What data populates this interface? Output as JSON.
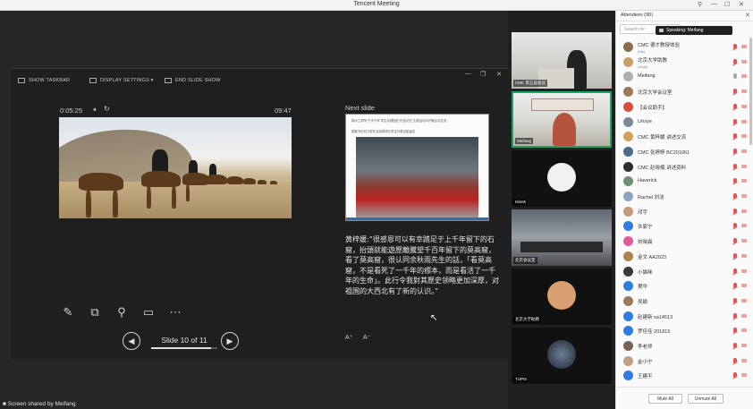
{
  "window": {
    "title": "Tencent Meeting",
    "controls": [
      "⚲",
      "—",
      "☐",
      "✕"
    ]
  },
  "presenter": {
    "toolbar": {
      "show_taskbar": "SHOW TASKBAR",
      "display_settings": "DISPLAY SETTINGS ▾",
      "end_slide_show": "END SLIDE SHOW"
    },
    "window_controls": [
      "—",
      "❐",
      "✕"
    ],
    "timer": "0:05:25",
    "pause_glyph": "⏸",
    "reset_glyph": "↻",
    "clock": "09:47",
    "tool_glyphs": [
      "✎",
      "⧉",
      "⚲",
      "▭",
      "⋯"
    ],
    "slide_counter": "Slide 10 of 11",
    "slide_progress": 0.909,
    "prev_glyph": "◀",
    "next_glyph": "▶",
    "next_slide_label": "Next slide",
    "next_slide_text1": "锦州工学院“千手千年”学生实践团在“红色记忆”主题活动中开展互动交流",
    "next_slide_text2": "团委书记刘力宏在活动现场与学生代表合影留念",
    "notes": "黄梓媛:“很感恩可以有幸踏足于上千年留下的石窟，抬頭就能遊歷離騰望千百年留下的莫高窟，看了莫高窟，很认同余秋雨先生的話，「看莫高窟，不是看死了一千年的標本，而是看活了一千年的生命」。此行令我對其歷史领略更加深厚，对祖国的大西北有了新的认识。”",
    "font_up": "A⁺",
    "font_down": "A⁻",
    "cursor_glyph": "↖"
  },
  "status_bar": {
    "text": "Screen shared by Meifang",
    "glyph": "■"
  },
  "video_tiles": [
    {
      "label": "CMC 第五届会议"
    },
    {
      "label": "Meifang"
    },
    {
      "label": "MinMi"
    },
    {
      "label": "北京会议室"
    },
    {
      "label": "北京大学助教"
    },
    {
      "label": "TUPM"
    }
  ],
  "attendees": {
    "title": "Attendees (90)",
    "close_glyph": "✕",
    "search_placeholder": "Search for",
    "speaking": "Speaking: Meifang",
    "list": [
      {
        "name": "CMC 德才教授体验",
        "sub": "(Me)",
        "color": "#8a6d4f",
        "mic": "muted"
      },
      {
        "name": "北京大学助教",
        "sub": "(Host)",
        "color": "#c9a06a",
        "mic": "muted"
      },
      {
        "name": "Meifang",
        "sub": "",
        "color": "#b0b0b0",
        "mic": "grey"
      },
      {
        "name": "北京大学会议室",
        "sub": "",
        "color": "#9c7c56",
        "mic": "muted"
      },
      {
        "name": "【会议助手】",
        "sub": "",
        "color": "#d94f3d",
        "mic": "muted"
      },
      {
        "name": "Lihsye",
        "sub": "",
        "color": "#7a8a9a",
        "mic": "muted"
      },
      {
        "name": "CMC 黄梓媛 讲述交流",
        "sub": "",
        "color": "#d4a05a",
        "mic": "muted"
      },
      {
        "name": "CMC 张婷婷 BC201061",
        "sub": "",
        "color": "#4d6b8a",
        "mic": "muted"
      },
      {
        "name": "CMC 赵晓楠 讲述资料",
        "sub": "",
        "color": "#2e2e2e",
        "mic": "muted"
      },
      {
        "name": "Haverick",
        "sub": "",
        "color": "#6f8f6f",
        "mic": "muted"
      },
      {
        "name": "Rachel 刘洁",
        "sub": "",
        "color": "#8fa5bf",
        "mic": "muted"
      },
      {
        "name": "邓宇",
        "sub": "",
        "color": "#c49a7a",
        "mic": "muted"
      },
      {
        "name": "许家宁",
        "sub": "",
        "color": "#2f7de1",
        "mic": "muted"
      },
      {
        "name": "刘晓晨",
        "sub": "",
        "color": "#e05a9a",
        "mic": "muted"
      },
      {
        "name": "金文 AA2023",
        "sub": "",
        "color": "#b08050",
        "mic": "muted"
      },
      {
        "name": "小猫咪",
        "sub": "",
        "color": "#3a3a3a",
        "mic": "muted"
      },
      {
        "name": "樊华",
        "sub": "",
        "color": "#2f7de1",
        "mic": "muted"
      },
      {
        "name": "吴颖",
        "sub": "",
        "color": "#9a7a5a",
        "mic": "muted"
      },
      {
        "name": "赵建新 xa14513",
        "sub": "",
        "color": "#2f7de1",
        "mic": "muted"
      },
      {
        "name": "罗佳佳 201815",
        "sub": "",
        "color": "#2f7de1",
        "mic": "muted"
      },
      {
        "name": "李老师",
        "sub": "",
        "color": "#7a6050",
        "mic": "muted"
      },
      {
        "name": "金小宁",
        "sub": "",
        "color": "#c0a080",
        "mic": "muted"
      },
      {
        "name": "王建平",
        "sub": "",
        "color": "#2f7de1",
        "mic": "muted"
      }
    ],
    "mute_all": "Mute All",
    "unmute_all": "Unmute All"
  }
}
